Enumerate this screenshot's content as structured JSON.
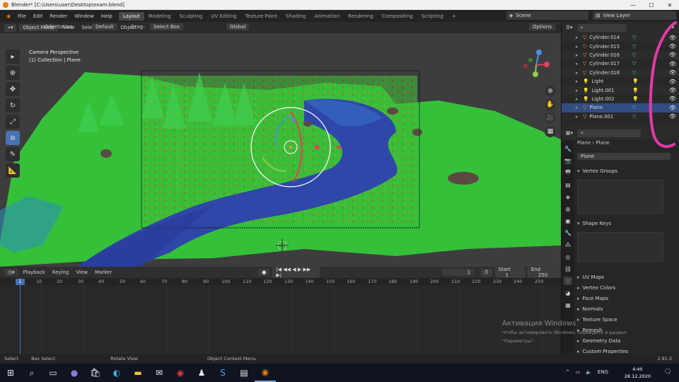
{
  "window": {
    "title": "Blender* [C:\\Users\\user\\Desktop\\exam.blend]"
  },
  "menu": [
    "File",
    "Edit",
    "Render",
    "Window",
    "Help"
  ],
  "workspaces": [
    "Layout",
    "Modeling",
    "Sculpting",
    "UV Editing",
    "Texture Paint",
    "Shading",
    "Animation",
    "Rendering",
    "Compositing",
    "Scripting"
  ],
  "active_workspace": "Layout",
  "scene": "Scene",
  "view_layer": "View Layer",
  "viewport_header": {
    "mode": "Object Mode",
    "view": "View",
    "select": "Select",
    "add": "Add",
    "object": "Object",
    "orientation_label": "Orientation:",
    "orientation": "Default",
    "drag_label": "Drag:",
    "drag": "Select Box",
    "transform": "Global",
    "options": "Options"
  },
  "viewport": {
    "camera_label": "Camera Perspective",
    "collection_label": "(1) Collection | Plane"
  },
  "outliner": {
    "rows": [
      {
        "name": "Cylinder.014",
        "type": "mesh"
      },
      {
        "name": "Cylinder.015",
        "type": "mesh"
      },
      {
        "name": "Cylinder.016",
        "type": "mesh"
      },
      {
        "name": "Cylinder.017",
        "type": "mesh"
      },
      {
        "name": "Cylinder.018",
        "type": "mesh"
      },
      {
        "name": "Light",
        "type": "light"
      },
      {
        "name": "Light.001",
        "type": "light"
      },
      {
        "name": "Light.002",
        "type": "light"
      },
      {
        "name": "Plane",
        "type": "mesh",
        "selected": true
      },
      {
        "name": "Plane.001",
        "type": "mesh"
      }
    ]
  },
  "properties": {
    "breadcrumb": [
      "Plane",
      "Plane"
    ],
    "data_name": "Plane",
    "vertex_groups": "Vertex Groups",
    "shape_keys": "Shape Keys",
    "collapsed": [
      "UV Maps",
      "Vertex Colors",
      "Face Maps",
      "Normals",
      "Texture Space",
      "Remesh",
      "Geometry Data",
      "Custom Properties"
    ]
  },
  "timeline": {
    "menus": [
      "Playback",
      "Keying",
      "View",
      "Marker"
    ],
    "current_frame": "1",
    "start_label": "Start",
    "start": "1",
    "end_label": "End",
    "end": "250",
    "ruler": [
      "1",
      "10",
      "20",
      "30",
      "40",
      "50",
      "60",
      "70",
      "80",
      "90",
      "100",
      "110",
      "120",
      "130",
      "140",
      "150",
      "160",
      "170",
      "180",
      "190",
      "200",
      "210",
      "220",
      "230",
      "240",
      "250"
    ],
    "playhead": "1"
  },
  "statusbar": {
    "select": "Select",
    "box_select": "Box Select",
    "rotate_view": "Rotate View",
    "context_menu": "Object Context Menu",
    "version": "2.91.0"
  },
  "watermark": {
    "line1": "Активация Windows",
    "line2": "Чтобы активировать Windows, перейдите в раздел",
    "line3": "\"Параметры\"."
  },
  "taskbar": {
    "time": "4:40",
    "date": "28.12.2020",
    "lang": "ENG"
  },
  "colors": {
    "accent": "#4772b3",
    "terrain_green": "#35c03a",
    "water_blue": "#2f47a8",
    "selection_orange": "#e79a3c",
    "annotation_pink": "#e23aa8"
  }
}
